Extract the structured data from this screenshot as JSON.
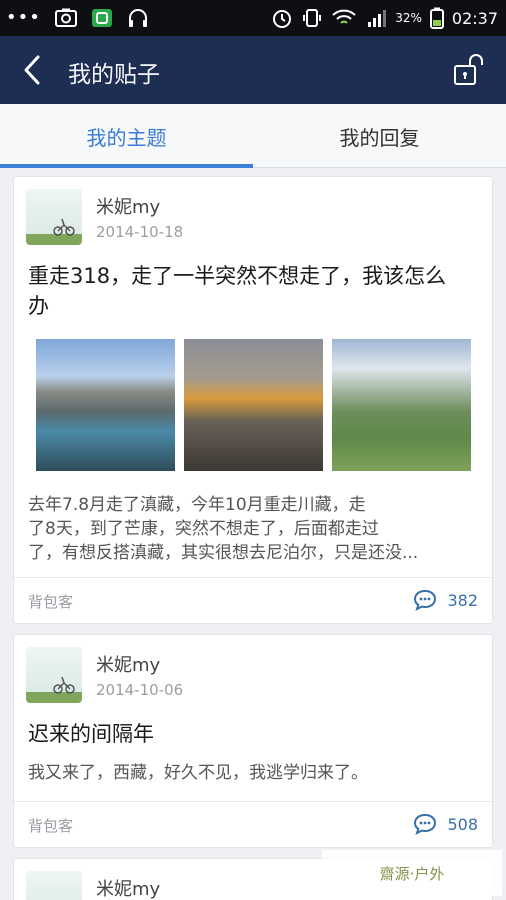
{
  "status_bar": {
    "battery": "32%",
    "time": "02:37"
  },
  "navbar": {
    "title": "我的贴子"
  },
  "tabs": [
    {
      "label": "我的主题"
    },
    {
      "label": "我的回复"
    }
  ],
  "posts": [
    {
      "author": "米妮my",
      "date": "2014-10-18",
      "title_line1": "重走318，走了一半突然不想走了，我该怎么",
      "title_line2": "办",
      "excerpt_line1": "去年7.8月走了滇藏，今年10月重走川藏，走",
      "excerpt_line2": "了8天，到了芒康，突然不想走了，后面都走过",
      "excerpt_line3": "了，有想反搭滇藏，其实很想去尼泊尔，只是还没...",
      "category": "背包客",
      "comment_count": "382"
    },
    {
      "author": "米妮my",
      "date": "2014-10-06",
      "title_line1": "迟来的间隔年",
      "excerpt_line1": "我又来了，西藏，好久不见，我逃学归来了。",
      "category": "背包客",
      "comment_count": "508"
    },
    {
      "author": "米妮my"
    }
  ],
  "watermark": {
    "text": "齋源·户外"
  }
}
